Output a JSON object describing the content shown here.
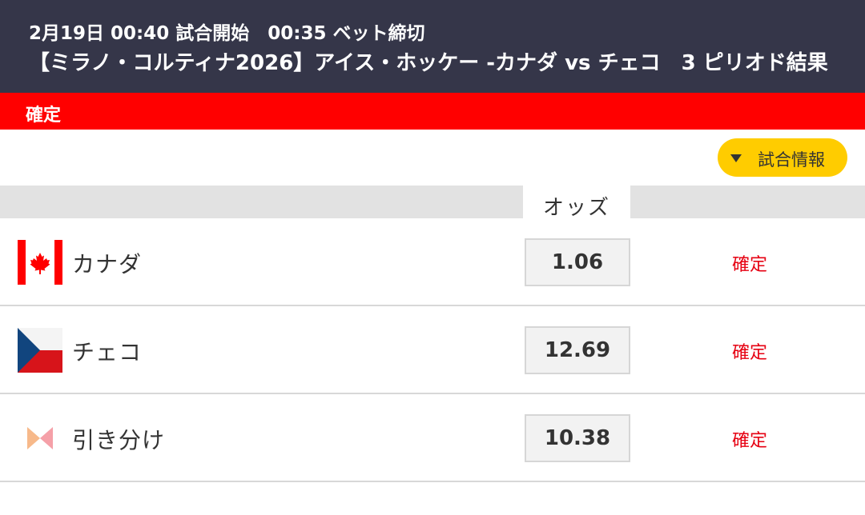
{
  "header": {
    "time_line": "2月19日 00:40 試合開始　00:35 ベット締切",
    "match_title": "【ミラノ・コルティナ2026】アイス・ホッケー -カナダ vs チェコ　3 ピリオド結果"
  },
  "status": {
    "label": "確定",
    "color": "#ff0000"
  },
  "info_button": {
    "label": "試合情報",
    "icon": "caret-down-icon",
    "color": "#ffcc00"
  },
  "odds_header": {
    "label": "オッズ"
  },
  "rows": [
    {
      "name": "カナダ",
      "flag": "canada-flag-icon",
      "odds": "1.06",
      "result": "確定"
    },
    {
      "name": "チェコ",
      "flag": "czech-flag-icon",
      "odds": "12.69",
      "result": "確定"
    },
    {
      "name": "引き分け",
      "flag": "draw-icon",
      "odds": "10.38",
      "result": "確定"
    }
  ],
  "colors": {
    "header_bg": "#353649",
    "result_text": "#e60012",
    "canada_red": "#ff0000",
    "czech_blue": "#11457e",
    "czech_red": "#d7141a",
    "draw_orange": "#f7b98a",
    "draw_pink": "#f5a0a8"
  }
}
